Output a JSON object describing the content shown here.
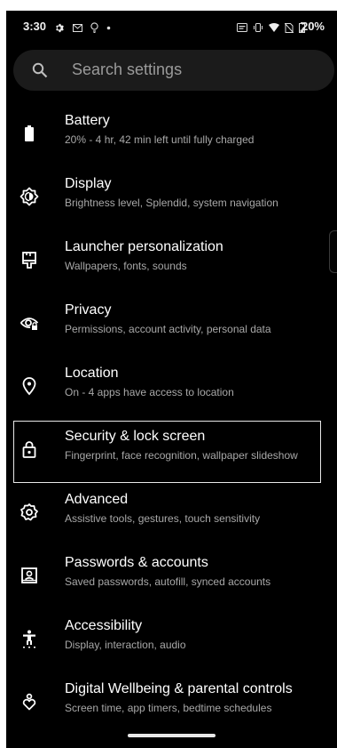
{
  "status_bar": {
    "time": "3:30",
    "battery_percent": "20%",
    "left_icons": [
      "gear-icon",
      "mail-icon",
      "bulb-icon",
      "dot-icon"
    ],
    "right_icons": [
      "cast-icon",
      "vibrate-icon",
      "wifi-icon",
      "no-sim-icon",
      "battery-icon"
    ]
  },
  "search": {
    "placeholder": "Search settings"
  },
  "settings": {
    "items": [
      {
        "title": "Battery",
        "subtitle": "20% - 4 hr, 42 min left until fully charged",
        "icon": "battery-icon"
      },
      {
        "title": "Display",
        "subtitle": "Brightness level, Splendid, system navigation",
        "icon": "display-brightness-icon"
      },
      {
        "title": "Launcher personalization",
        "subtitle": "Wallpapers, fonts, sounds",
        "icon": "paint-brush-icon"
      },
      {
        "title": "Privacy",
        "subtitle": "Permissions, account activity, personal data",
        "icon": "privacy-eye-icon"
      },
      {
        "title": "Location",
        "subtitle": "On - 4 apps have access to location",
        "icon": "location-pin-icon"
      },
      {
        "title": "Security & lock screen",
        "subtitle": "Fingerprint, face recognition, wallpaper slideshow",
        "icon": "lock-icon",
        "selected": true
      },
      {
        "title": "Advanced",
        "subtitle": "Assistive tools, gestures, touch sensitivity",
        "icon": "advanced-gear-icon"
      },
      {
        "title": "Passwords & accounts",
        "subtitle": "Saved passwords, autofill, synced accounts",
        "icon": "account-box-icon"
      },
      {
        "title": "Accessibility",
        "subtitle": "Display, interaction, audio",
        "icon": "accessibility-icon"
      },
      {
        "title": "Digital Wellbeing & parental controls",
        "subtitle": "Screen time, app timers, bedtime schedules",
        "icon": "wellbeing-icon"
      }
    ]
  },
  "colors": {
    "background": "#000000",
    "search_bar": "#1b1b1b",
    "title_text": "#ffffff",
    "subtitle_text": "#a8a8a8",
    "selection_border": "#e8e8e8"
  }
}
